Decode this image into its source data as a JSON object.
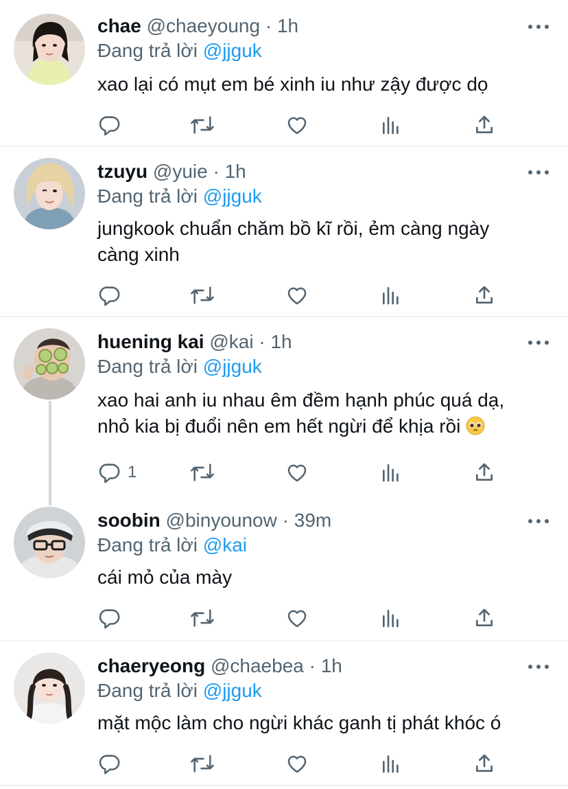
{
  "tweets": [
    {
      "name": "chae",
      "handle": "@chaeyoung",
      "dot": "·",
      "time": "1h",
      "replying_prefix": "Đang trả lời ",
      "replying_to": "@jjguk",
      "text": "xao lại có mụt em bé xinh iu như zậy được dọ",
      "reply_count": ""
    },
    {
      "name": "tzuyu",
      "handle": "@yuie",
      "dot": "·",
      "time": "1h",
      "replying_prefix": "Đang trả lời ",
      "replying_to": "@jjguk",
      "text_line1": "jungkook chuẩn chăm bồ kĩ rồi, ẻm càng ngày",
      "text_line2": "càng xinh",
      "reply_count": ""
    },
    {
      "name": "huening kai",
      "handle": "@kai",
      "dot": "·",
      "time": "1h",
      "replying_prefix": "Đang trả lời ",
      "replying_to": "@jjguk",
      "text_line1": "xao hai anh iu nhau êm đềm hạnh phúc quá dạ,",
      "text_line2": "nhỏ kia bị đuổi nên em hết ngừi để khịa rồi",
      "reply_count": "1"
    },
    {
      "name": "soobin",
      "handle": "@binyounow",
      "dot": "·",
      "time": "39m",
      "replying_prefix": "Đang trả lời ",
      "replying_to": "@kai",
      "text": "cái mỏ của mày",
      "reply_count": ""
    },
    {
      "name": "chaeryeong",
      "handle": "@chaebea",
      "dot": "·",
      "time": "1h",
      "replying_prefix": "Đang trả lời ",
      "replying_to": "@jjguk",
      "text": "mặt mộc làm cho ngừi khác ganh tị phát khóc ó",
      "reply_count": ""
    }
  ],
  "icons": {
    "reply": "reply-icon",
    "retweet": "retweet-icon",
    "like": "heart-icon",
    "views": "analytics-icon",
    "share": "share-icon",
    "more": "more-icon",
    "emoji": "pleading-face-emoji"
  },
  "colors": {
    "name": "#0f1419",
    "secondary": "#536471",
    "mention": "#1d9bf0",
    "separator": "#eff3f4",
    "thread_line": "#cfd9de"
  }
}
